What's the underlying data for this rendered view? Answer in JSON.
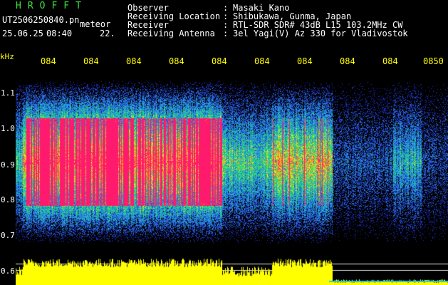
{
  "header": {
    "app_title": "HROFFT",
    "file_name": "UT2506250840.pn",
    "mode": "meteor",
    "date": "25.06.25",
    "time": "08:40",
    "number": "22.",
    "fields": [
      {
        "key": "Observer",
        "sep": ":",
        "value": "Masaki Kano"
      },
      {
        "key": "Receiving Location",
        "sep": ":",
        "value": "Shibukawa, Gunma, Japan"
      },
      {
        "key": "Receiver",
        "sep": ":",
        "value": "RTL-SDR SDR# 43dB L15 103.2MHz CW"
      },
      {
        "key": "Receiving Antenna",
        "sep": ":",
        "value": "3el Yagi(V) Az 330 for Vladivostok"
      }
    ]
  },
  "axis": {
    "unit": "kHz",
    "time_ticks": [
      "084",
      "084",
      "084",
      "084",
      "084",
      "084",
      "084",
      "084",
      "084",
      "0850"
    ],
    "freq_ticks": [
      "1.1",
      "1.0",
      "0.9",
      "0.8",
      "0.7",
      "0.6"
    ]
  },
  "colors": {
    "background": "#000000",
    "title": "#3fe23f",
    "axis_labels": "#ffff00",
    "signal_high": "#ff1a6e",
    "signal_mid": "#2ee05a",
    "signal_low": "#2a4fd8",
    "level_trace": "#ffff00",
    "reference_line": "#e0e0e0"
  }
}
